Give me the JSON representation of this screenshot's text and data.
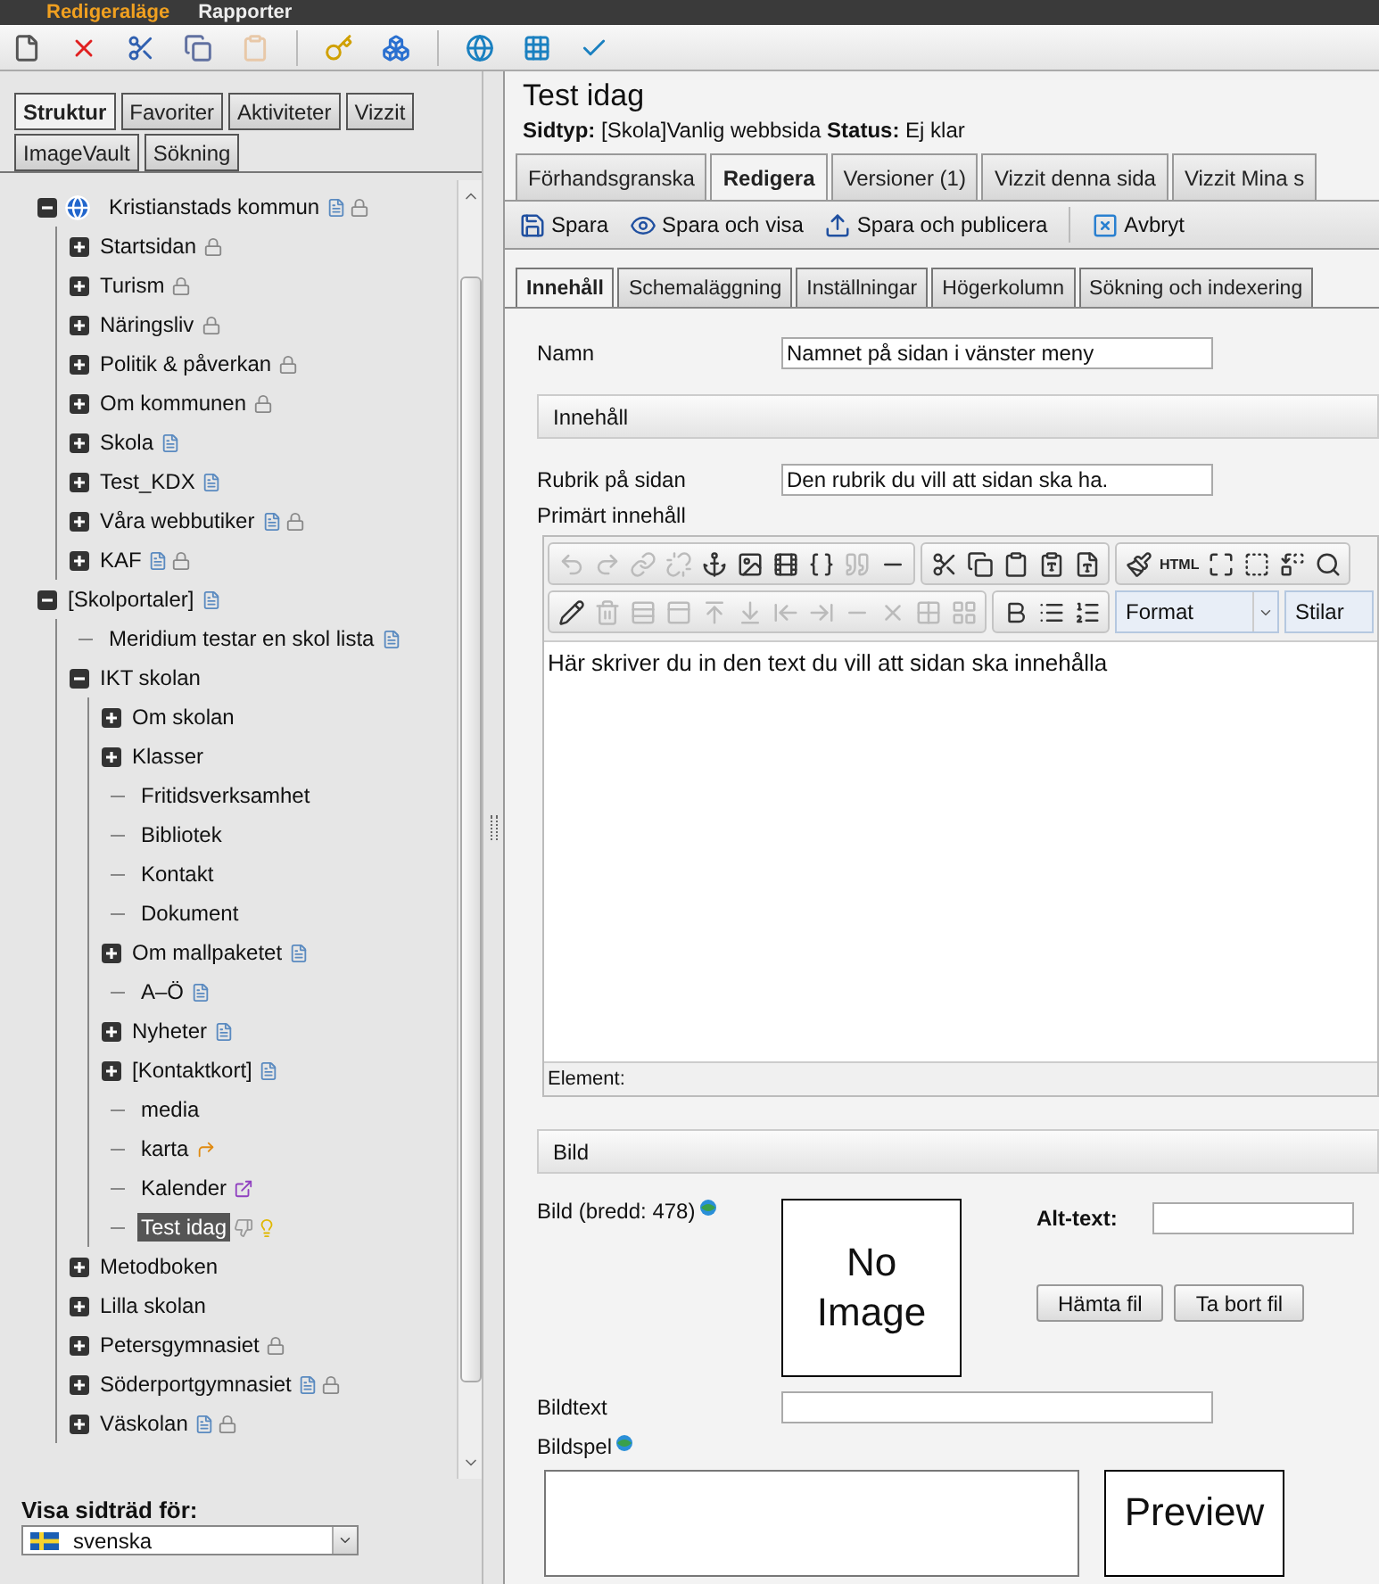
{
  "menu_bar": [
    {
      "label": "Redigeraläge",
      "selected": true
    },
    {
      "label": "Rapporter",
      "selected": false
    }
  ],
  "toolbar": [
    {
      "items": [
        {
          "kind": "new",
          "disabled": false
        },
        {
          "kind": "delete",
          "disabled": false
        },
        {
          "kind": "cut",
          "disabled": false
        },
        {
          "kind": "copy",
          "disabled": false
        },
        {
          "kind": "paste",
          "disabled": true
        }
      ]
    },
    {
      "items": [
        {
          "kind": "key",
          "disabled": false
        },
        {
          "kind": "cubes",
          "disabled": false
        }
      ]
    },
    {
      "items": [
        {
          "kind": "globe-page",
          "disabled": false
        },
        {
          "kind": "globe-grid",
          "disabled": false
        },
        {
          "kind": "globe-check",
          "disabled": false
        }
      ]
    }
  ],
  "left_tabs": [
    {
      "label": "Struktur",
      "selected": true
    },
    {
      "label": "Favoriter",
      "selected": false
    },
    {
      "label": "Aktiviteter",
      "selected": false
    },
    {
      "label": "Vizzit",
      "selected": false
    },
    {
      "label": "ImageVault",
      "selected": false
    },
    {
      "label": "Sökning",
      "selected": false
    }
  ],
  "tree": [
    {
      "label": "Kristianstads kommun",
      "kind": "site",
      "expanded": true,
      "selected": false,
      "markers": [
        {
          "kind": "page"
        },
        {
          "kind": "lock"
        }
      ],
      "children": [
        {
          "label": "Startsidan",
          "kind": "branch",
          "expanded": false,
          "selected": false,
          "markers": [
            {
              "kind": "lock"
            }
          ]
        },
        {
          "label": "Turism",
          "kind": "branch",
          "expanded": false,
          "selected": false,
          "markers": [
            {
              "kind": "lock"
            }
          ]
        },
        {
          "label": "Näringsliv",
          "kind": "branch",
          "expanded": false,
          "selected": false,
          "markers": [
            {
              "kind": "lock"
            }
          ]
        },
        {
          "label": "Politik & påverkan",
          "kind": "branch",
          "expanded": false,
          "selected": false,
          "markers": [
            {
              "kind": "lock"
            }
          ]
        },
        {
          "label": "Om kommunen",
          "kind": "branch",
          "expanded": false,
          "selected": false,
          "markers": [
            {
              "kind": "lock"
            }
          ]
        },
        {
          "label": "Skola",
          "kind": "branch",
          "expanded": false,
          "selected": false,
          "markers": [
            {
              "kind": "page"
            }
          ]
        },
        {
          "label": "Test_KDX",
          "kind": "branch",
          "expanded": false,
          "selected": false,
          "markers": [
            {
              "kind": "page"
            }
          ]
        },
        {
          "label": "Våra webbutiker",
          "kind": "branch",
          "expanded": false,
          "selected": false,
          "markers": [
            {
              "kind": "page"
            },
            {
              "kind": "lock"
            }
          ]
        },
        {
          "label": "KAF",
          "kind": "branch",
          "expanded": false,
          "selected": false,
          "markers": [
            {
              "kind": "page"
            },
            {
              "kind": "lock"
            }
          ]
        }
      ]
    },
    {
      "label": "[Skolportaler]",
      "kind": "branch",
      "expanded": true,
      "selected": false,
      "markers": [
        {
          "kind": "page"
        }
      ],
      "children": [
        {
          "label": "Meridium testar en skol lista",
          "kind": "leaf",
          "selected": false,
          "markers": [
            {
              "kind": "page"
            }
          ]
        },
        {
          "label": "IKT skolan",
          "kind": "branch",
          "expanded": true,
          "selected": false,
          "children": [
            {
              "label": "Om skolan",
              "kind": "branch",
              "expanded": false,
              "selected": false
            },
            {
              "label": "Klasser",
              "kind": "branch",
              "expanded": false,
              "selected": false
            },
            {
              "label": "Fritidsverksamhet",
              "kind": "leaf",
              "selected": false
            },
            {
              "label": "Bibliotek",
              "kind": "leaf",
              "selected": false
            },
            {
              "label": "Kontakt",
              "kind": "leaf",
              "selected": false
            },
            {
              "label": "Dokument",
              "kind": "leaf",
              "selected": false
            },
            {
              "label": "Om mallpaketet",
              "kind": "branch",
              "expanded": false,
              "selected": false,
              "markers": [
                {
                  "kind": "page"
                }
              ]
            },
            {
              "label": "A–Ö",
              "kind": "leaf",
              "selected": false,
              "markers": [
                {
                  "kind": "page"
                }
              ]
            },
            {
              "label": "Nyheter",
              "kind": "branch",
              "expanded": false,
              "selected": false,
              "markers": [
                {
                  "kind": "page"
                }
              ]
            },
            {
              "label": "[Kontaktkort]",
              "kind": "branch",
              "expanded": false,
              "selected": false,
              "markers": [
                {
                  "kind": "page"
                }
              ]
            },
            {
              "label": "media",
              "kind": "leaf",
              "selected": false
            },
            {
              "label": "karta",
              "kind": "leaf",
              "selected": false,
              "markers": [
                {
                  "kind": "shortcut"
                }
              ]
            },
            {
              "label": "Kalender",
              "kind": "leaf",
              "selected": false,
              "markers": [
                {
                  "kind": "external"
                }
              ]
            },
            {
              "label": "Test idag",
              "kind": "leaf",
              "selected": true,
              "markers": [
                {
                  "kind": "thumb"
                },
                {
                  "kind": "bulb"
                }
              ]
            }
          ]
        },
        {
          "label": "Metodboken",
          "kind": "branch",
          "expanded": false,
          "selected": false
        },
        {
          "label": "Lilla skolan",
          "kind": "branch",
          "expanded": false,
          "selected": false
        },
        {
          "label": "Petersgymnasiet",
          "kind": "branch",
          "expanded": false,
          "selected": false,
          "markers": [
            {
              "kind": "lock"
            }
          ]
        },
        {
          "label": "Söderportgymnasiet",
          "kind": "branch",
          "expanded": false,
          "selected": false,
          "markers": [
            {
              "kind": "page"
            },
            {
              "kind": "lock"
            }
          ]
        },
        {
          "label": "Väskolan",
          "kind": "branch",
          "expanded": false,
          "selected": false,
          "markers": [
            {
              "kind": "page"
            },
            {
              "kind": "lock"
            }
          ]
        }
      ]
    }
  ],
  "language": {
    "label": "Visa sidträd för:",
    "value": "svenska"
  },
  "page": {
    "title": "Test idag",
    "meta": "**Sidtyp:** [Skola]Vanlig webbsida **Status:** Ej klar"
  },
  "main_tabs": [
    {
      "label": "Förhandsgranska",
      "selected": false
    },
    {
      "label": "Redigera",
      "selected": true
    },
    {
      "label": "Versioner (1)",
      "selected": false
    },
    {
      "label": "Vizzit denna sida",
      "selected": false
    },
    {
      "label": "Vizzit Mina s",
      "selected": false
    }
  ],
  "actions": [
    {
      "kind": "save",
      "label": "Spara"
    },
    {
      "kind": "save-view",
      "label": "Spara och visa"
    },
    {
      "kind": "publish",
      "label": "Spara och publicera"
    },
    {
      "kind": "cancel",
      "label": "Avbryt"
    }
  ],
  "sub_tabs": [
    {
      "label": "Innehåll",
      "selected": true
    },
    {
      "label": "Schemaläggning",
      "selected": false
    },
    {
      "label": "Inställningar",
      "selected": false
    },
    {
      "label": "Högerkolumn",
      "selected": false
    },
    {
      "label": "Sökning och indexering",
      "selected": false
    }
  ],
  "form": {
    "name": {
      "label": "Namn",
      "value": "Namnet på sidan i vänster meny"
    },
    "content_section": "Innehåll",
    "heading": {
      "label": "Rubrik på sidan",
      "value": "Den rubrik du vill att sidan ska ha."
    },
    "editor": {
      "label": "Primärt innehåll",
      "toolbar_1": [
        {
          "items": [
            {
              "kind": "undo",
              "disabled": true
            },
            {
              "kind": "redo",
              "disabled": true
            },
            {
              "kind": "link",
              "disabled": true
            },
            {
              "kind": "unlink",
              "disabled": true
            },
            {
              "kind": "anchor",
              "disabled": false
            },
            {
              "kind": "image",
              "disabled": false
            },
            {
              "kind": "media",
              "disabled": false
            },
            {
              "kind": "code",
              "disabled": false
            },
            {
              "kind": "quote",
              "disabled": true
            },
            {
              "kind": "rule",
              "disabled": false
            }
          ]
        },
        {
          "items": [
            {
              "kind": "cut",
              "disabled": false
            },
            {
              "kind": "copy",
              "disabled": false
            },
            {
              "kind": "paste",
              "disabled": false
            },
            {
              "kind": "paste-text",
              "disabled": false
            },
            {
              "kind": "paste-word",
              "disabled": false
            }
          ]
        },
        {
          "items": [
            {
              "kind": "clean",
              "disabled": false
            },
            {
              "kind": "html",
              "disabled": false,
              "label": "HTML"
            },
            {
              "kind": "fullscreen",
              "disabled": false
            },
            {
              "kind": "select",
              "disabled": false
            },
            {
              "kind": "replace",
              "disabled": false
            },
            {
              "kind": "find",
              "disabled": false
            }
          ]
        }
      ],
      "toolbar_2": [
        {
          "items": [
            {
              "kind": "table",
              "disabled": false
            },
            {
              "kind": "table-delete",
              "disabled": true
            },
            {
              "kind": "row",
              "disabled": true
            },
            {
              "kind": "cell",
              "disabled": true
            },
            {
              "kind": "row-before",
              "disabled": true
            },
            {
              "kind": "row-after",
              "disabled": true
            },
            {
              "kind": "col-before",
              "disabled": true
            },
            {
              "kind": "col-after",
              "disabled": true
            },
            {
              "kind": "row-delete",
              "disabled": true
            },
            {
              "kind": "col-delete",
              "disabled": true
            },
            {
              "kind": "merge",
              "disabled": true
            },
            {
              "kind": "split",
              "disabled": true
            }
          ]
        },
        {
          "items": [
            {
              "kind": "bold",
              "disabled": false
            },
            {
              "kind": "bullets",
              "disabled": false
            },
            {
              "kind": "numbers",
              "disabled": false
            }
          ]
        }
      ],
      "format": "Format",
      "styles": "Stilar",
      "body": "Här skriver du in den text du vill att sidan ska innehålla",
      "path_label": "Element:"
    },
    "image_section": "Bild",
    "image": {
      "label": "Bild (bredd: 478)",
      "empty": "No Image",
      "alt_label": "Alt-text:",
      "buttons": [
        "Hämta fil",
        "Ta bort fil"
      ]
    },
    "caption": {
      "label": "Bildtext"
    },
    "slideshow": {
      "label": "Bildspel",
      "preview": "Preview"
    }
  }
}
